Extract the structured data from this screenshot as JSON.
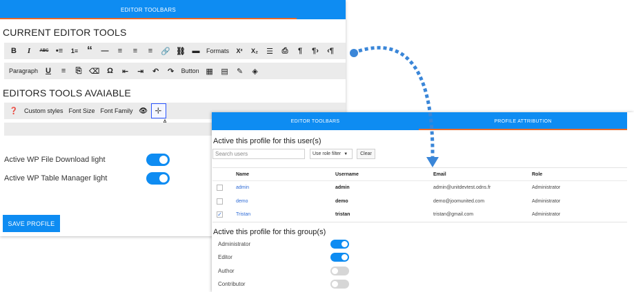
{
  "left_panel": {
    "tab_label": "EDITOR TOOLBARS",
    "current_tools_title": "CURRENT EDITOR TOOLS",
    "available_tools_title": "EDITORS TOOLS AVAIABLE",
    "toolbar_row1": {
      "bold": "B",
      "italic": "I",
      "strikethrough": "ABC",
      "bullet_list": "•≡",
      "numbered_list": "1≡",
      "blockquote": "“",
      "horizontal_rule": "—",
      "align_left": "≡",
      "align_center": "≡",
      "align_right": "≡",
      "link": "🔗",
      "unlink": "⛓",
      "read_more": "▬",
      "formats": "Formats",
      "superscript": "X²",
      "subscript": "X₂",
      "find_replace": "☰",
      "print": "⎙",
      "paragraph": "¶",
      "ltr": "¶›",
      "rtl": "‹¶"
    },
    "toolbar_row2": {
      "paragraph": "Paragraph",
      "underline": "U",
      "justify": "≡",
      "paste_text": "⎘",
      "clear_format": "⌫",
      "special_char": "Ω",
      "outdent": "⇤",
      "indent": "⇥",
      "undo": "↶",
      "redo": "↷",
      "button": "Button",
      "table": "▦",
      "template": "▤",
      "edit": "✎",
      "code": "◈"
    },
    "available_row": {
      "help": "❓",
      "custom_styles": "Custom styles",
      "font_size": "Font Size",
      "font_family": "Font Family",
      "preview": "👁",
      "drag_handle": "✛"
    },
    "cursor_label": "A",
    "toggles": [
      {
        "label": "Active WP File Download light",
        "on": true
      },
      {
        "label": "Active WP Table Manager light",
        "on": true
      }
    ],
    "save_label": "SAVE PROFILE"
  },
  "right_panel": {
    "tabs": [
      "EDITOR TOOLBARS",
      "PROFILE ATTRIBUTION"
    ],
    "users_heading": "Active this profile for this user(s)",
    "search_placeholder": "Search users",
    "role_filter": "Use role filter",
    "clear_label": "Clear",
    "table_headers": {
      "name": "Name",
      "username": "Username",
      "email": "Email",
      "role": "Role"
    },
    "users": [
      {
        "checked": false,
        "name": "admin",
        "username": "admin",
        "email": "admin@unitdevtest.odns.fr",
        "role": "Administrator"
      },
      {
        "checked": false,
        "name": "demo",
        "username": "demo",
        "email": "demo@joomunited.com",
        "role": "Administrator"
      },
      {
        "checked": true,
        "name": "Tristan",
        "username": "tristan",
        "email": "tristan@gmail.com",
        "role": "Administrator"
      }
    ],
    "groups_heading": "Active this profile for this group(s)",
    "groups": [
      {
        "label": "Administrator",
        "on": true
      },
      {
        "label": "Editor",
        "on": true
      },
      {
        "label": "Author",
        "on": false
      },
      {
        "label": "Contributor",
        "on": false
      }
    ]
  },
  "colors": {
    "accent": "#0e8cf2",
    "tab_underline": "#e86a2a",
    "arrow": "#3a86d8"
  }
}
